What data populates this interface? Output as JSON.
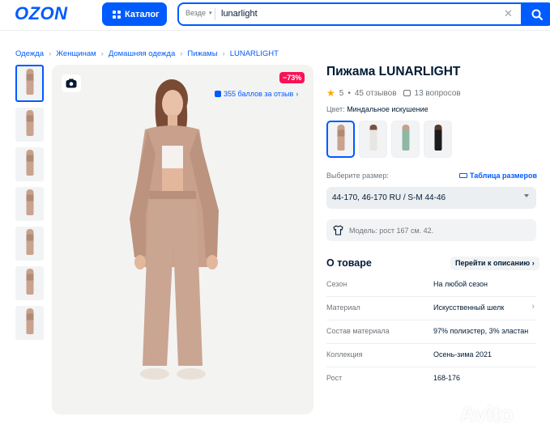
{
  "header": {
    "logo": "OZON",
    "catalog_label": "Каталог",
    "search_scope": "Везде",
    "search_query": "lunarlight"
  },
  "breadcrumb": [
    "Одежда",
    "Женщинам",
    "Домашняя одежда",
    "Пижамы",
    "LUNARLIGHT"
  ],
  "gallery": {
    "discount": "−73%",
    "bonus": "355 баллов за отзыв"
  },
  "product": {
    "title": "Пижама LUNARLIGHT",
    "rating": "5",
    "reviews": "45 отзывов",
    "questions": "13 вопросов",
    "color_label": "Цвет:",
    "color_value": "Миндальное искушение",
    "size_label": "Выберите размер:",
    "size_table": "Таблица размеров",
    "size_selected": "44-170, 46-170 RU / S-M 44-46",
    "model_info": "Модель: рост 167 см. 42."
  },
  "about": {
    "title": "О товаре",
    "link": "Перейти к описанию",
    "specs": [
      {
        "key": "Сезон",
        "value": "На любой сезон"
      },
      {
        "key": "Материал",
        "value": "Искусственный шелк"
      },
      {
        "key": "Состав материала",
        "value": "97% полиэстер, 3% эластан"
      },
      {
        "key": "Коллекция",
        "value": "Осень-зима 2021"
      },
      {
        "key": "Рост",
        "value": "168-176"
      }
    ]
  },
  "watermark": "Avito",
  "colors": {
    "accent": "#005bff",
    "discount": "#f91155",
    "star": "#ffa800"
  }
}
